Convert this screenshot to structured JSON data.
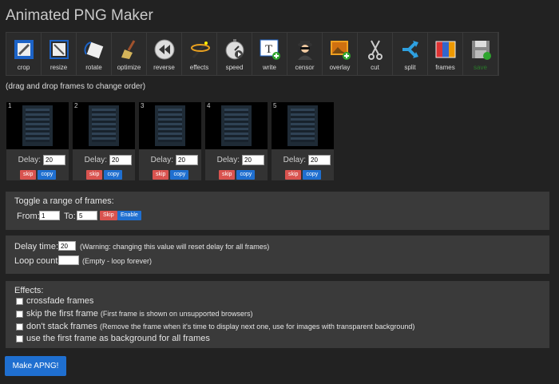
{
  "app": {
    "title": "Animated PNG Maker"
  },
  "toolbar": [
    {
      "label": "crop",
      "icon": "crop-icon"
    },
    {
      "label": "resize",
      "icon": "resize-icon"
    },
    {
      "label": "rotate",
      "icon": "rotate-icon"
    },
    {
      "label": "optimize",
      "icon": "broom-icon"
    },
    {
      "label": "reverse",
      "icon": "rewind-icon"
    },
    {
      "label": "effects",
      "icon": "magic-wand-icon"
    },
    {
      "label": "speed",
      "icon": "stopwatch-icon"
    },
    {
      "label": "write",
      "icon": "text-add-icon"
    },
    {
      "label": "censor",
      "icon": "spy-icon"
    },
    {
      "label": "overlay",
      "icon": "image-add-icon"
    },
    {
      "label": "cut",
      "icon": "scissors-icon"
    },
    {
      "label": "split",
      "icon": "split-arrows-icon"
    },
    {
      "label": "frames",
      "icon": "frames-icon"
    },
    {
      "label": "save",
      "icon": "floppy-disk-icon"
    }
  ],
  "hint": "(drag and drop frames to change order)",
  "frames": [
    {
      "index": "1",
      "delay_label": "Delay:",
      "delay": "20",
      "skip": "skip",
      "copy": "copy"
    },
    {
      "index": "2",
      "delay_label": "Delay:",
      "delay": "20",
      "skip": "skip",
      "copy": "copy"
    },
    {
      "index": "3",
      "delay_label": "Delay:",
      "delay": "20",
      "skip": "skip",
      "copy": "copy"
    },
    {
      "index": "4",
      "delay_label": "Delay:",
      "delay": "20",
      "skip": "skip",
      "copy": "copy"
    },
    {
      "index": "5",
      "delay_label": "Delay:",
      "delay": "20",
      "skip": "skip",
      "copy": "copy"
    }
  ],
  "range": {
    "title": "Toggle a range of frames:",
    "from_label": "From:",
    "from_value": "1",
    "to_label": "To:",
    "to_value": "5",
    "skip_label": "Skip",
    "enable_label": "Enable"
  },
  "timing": {
    "delay_label": "Delay time:",
    "delay_value": "20",
    "delay_note": "(Warning: changing this value will reset delay for all frames)",
    "loop_label": "Loop count:",
    "loop_value": "",
    "loop_note": "(Empty - loop forever)"
  },
  "effects": {
    "title": "Effects:",
    "options": [
      {
        "label": "crossfade frames",
        "note": ""
      },
      {
        "label": "skip the first frame",
        "note": "(First frame is shown on unsupported browsers)"
      },
      {
        "label": "don't stack frames",
        "note": "(Remove the frame when it's time to display next one, use for images with transparent background)"
      },
      {
        "label": "use the first frame as background for all frames",
        "note": ""
      }
    ]
  },
  "submit": "Make APNG!"
}
